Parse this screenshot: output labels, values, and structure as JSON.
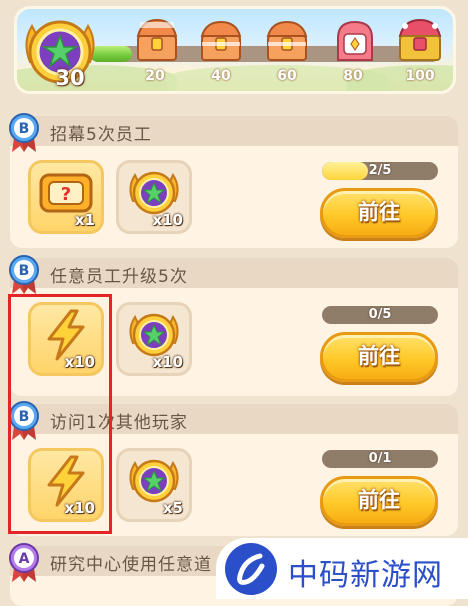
{
  "header": {
    "level": "30",
    "progress": 0.12,
    "milestones": [
      "20",
      "40",
      "60",
      "80",
      "100"
    ]
  },
  "tasks": [
    {
      "grade": "B",
      "title": "招幕5次员工",
      "rewards": [
        {
          "icon": "ticket-icon",
          "qty": "x1"
        },
        {
          "icon": "star-medal-icon",
          "qty": "x10"
        }
      ],
      "progress_text": "2/5",
      "progress": 0.4,
      "button": "前往"
    },
    {
      "grade": "B",
      "title": "任意员工升级5次",
      "rewards": [
        {
          "icon": "lightning-icon",
          "qty": "x10"
        },
        {
          "icon": "star-medal-icon",
          "qty": "x10"
        }
      ],
      "progress_text": "0/5",
      "progress": 0,
      "button": "前往"
    },
    {
      "grade": "B",
      "title": "访问1次其他玩家",
      "rewards": [
        {
          "icon": "lightning-icon",
          "qty": "x10"
        },
        {
          "icon": "star-medal-icon",
          "qty": "x5"
        }
      ],
      "progress_text": "0/1",
      "progress": 0,
      "button": "前往"
    },
    {
      "grade": "A",
      "title": "研究中心使用任意道"
    }
  ],
  "watermark": "中码新游网",
  "colors": {
    "accent": "#ffc92a",
    "highlight": "#e52525",
    "watermark": "#2b4fc9"
  }
}
